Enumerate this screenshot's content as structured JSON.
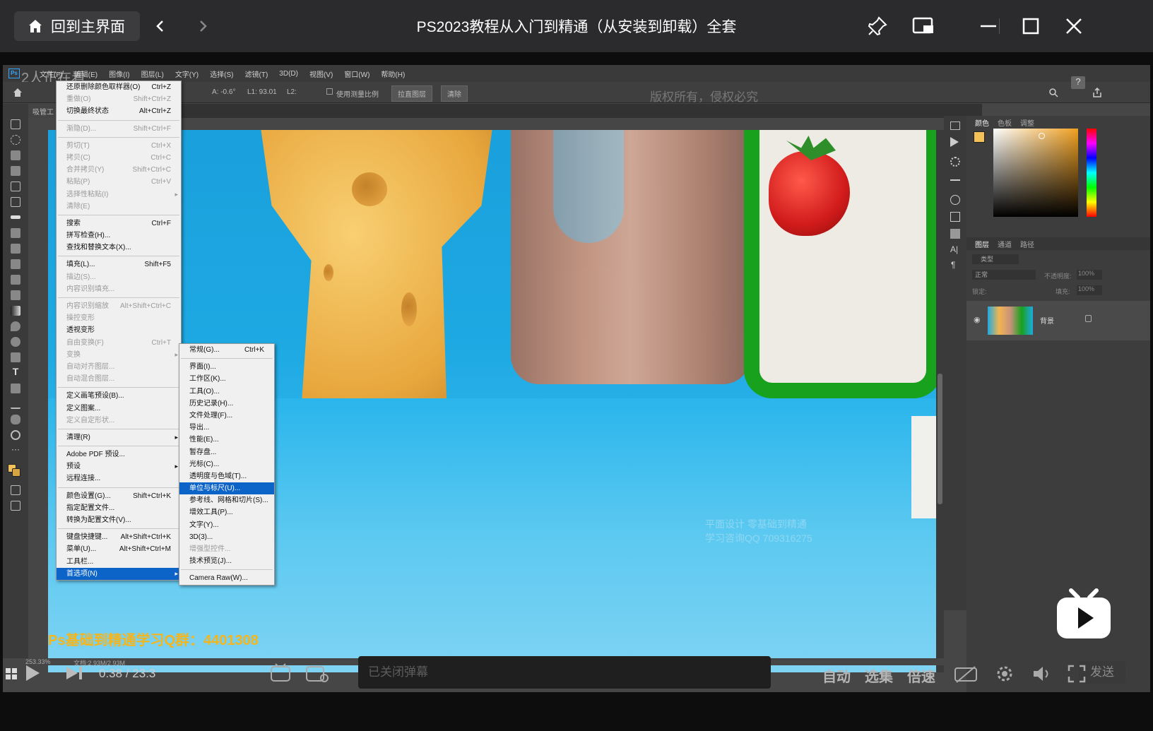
{
  "titlebar": {
    "home_label": "回到主界面",
    "title": "PS2023教程从入门到精通（从安装到卸载）全套"
  },
  "ps": {
    "menubar": [
      "文件(F)",
      "编辑(E)",
      "图像(I)",
      "图层(L)",
      "文字(Y)",
      "选择(S)",
      "滤镜(T)",
      "3D(D)",
      "视图(V)",
      "窗口(W)",
      "帮助(H)"
    ],
    "overlay_text": "2人正在看",
    "options": {
      "a": "A: -0.6°",
      "l1": "L1: 93.01",
      "l2": "L2:",
      "use_scale": "使用测量比例",
      "straighten": "拉直图层",
      "clear": "清除",
      "copyright": "版权所有，侵权必究"
    },
    "doc_tab": "吸管工",
    "status_zoom": "253.33%",
    "status_doc": "文档:2.93M/2.93M"
  },
  "edit_menu": [
    {
      "label": "还原删除颜色取样器(O)",
      "shortcut": "Ctrl+Z"
    },
    {
      "label": "重做(O)",
      "shortcut": "Shift+Ctrl+Z",
      "disabled": true
    },
    {
      "label": "切换最终状态",
      "shortcut": "Alt+Ctrl+Z"
    },
    {
      "sep": true
    },
    {
      "label": "渐隐(D)...",
      "shortcut": "Shift+Ctrl+F",
      "disabled": true
    },
    {
      "sep": true
    },
    {
      "label": "剪切(T)",
      "shortcut": "Ctrl+X",
      "disabled": true
    },
    {
      "label": "拷贝(C)",
      "shortcut": "Ctrl+C",
      "disabled": true
    },
    {
      "label": "合并拷贝(Y)",
      "shortcut": "Shift+Ctrl+C",
      "disabled": true
    },
    {
      "label": "粘贴(P)",
      "shortcut": "Ctrl+V",
      "disabled": true
    },
    {
      "label": "选择性粘贴(I)",
      "shortcut": "",
      "disabled": true,
      "submenu": true
    },
    {
      "label": "清除(E)",
      "shortcut": "",
      "disabled": true
    },
    {
      "sep": true
    },
    {
      "label": "搜索",
      "shortcut": "Ctrl+F"
    },
    {
      "label": "拼写检查(H)...",
      "shortcut": ""
    },
    {
      "label": "查找和替换文本(X)...",
      "shortcut": ""
    },
    {
      "sep": true
    },
    {
      "label": "填充(L)...",
      "shortcut": "Shift+F5"
    },
    {
      "label": "描边(S)...",
      "shortcut": "",
      "disabled": true
    },
    {
      "label": "内容识别填充...",
      "shortcut": "",
      "disabled": true
    },
    {
      "sep": true
    },
    {
      "label": "内容识别缩放",
      "shortcut": "Alt+Shift+Ctrl+C",
      "disabled": true
    },
    {
      "label": "操控变形",
      "shortcut": "",
      "disabled": true
    },
    {
      "label": "透视变形",
      "shortcut": ""
    },
    {
      "label": "自由变换(F)",
      "shortcut": "Ctrl+T",
      "disabled": true
    },
    {
      "label": "变换",
      "shortcut": "",
      "disabled": true,
      "submenu": true
    },
    {
      "label": "自动对齐图层...",
      "shortcut": "",
      "disabled": true
    },
    {
      "label": "自动混合图层...",
      "shortcut": "",
      "disabled": true
    },
    {
      "sep": true
    },
    {
      "label": "定义画笔预设(B)...",
      "shortcut": ""
    },
    {
      "label": "定义图案...",
      "shortcut": ""
    },
    {
      "label": "定义自定形状...",
      "shortcut": "",
      "disabled": true
    },
    {
      "sep": true
    },
    {
      "label": "清理(R)",
      "shortcut": "",
      "submenu": true
    },
    {
      "sep": true
    },
    {
      "label": "Adobe PDF 预设...",
      "shortcut": ""
    },
    {
      "label": "预设",
      "shortcut": "",
      "submenu": true
    },
    {
      "label": "远程连接...",
      "shortcut": ""
    },
    {
      "sep": true
    },
    {
      "label": "颜色设置(G)...",
      "shortcut": "Shift+Ctrl+K"
    },
    {
      "label": "指定配置文件...",
      "shortcut": ""
    },
    {
      "label": "转换为配置文件(V)...",
      "shortcut": ""
    },
    {
      "sep": true
    },
    {
      "label": "键盘快捷键...",
      "shortcut": "Alt+Shift+Ctrl+K"
    },
    {
      "label": "菜单(U)...",
      "shortcut": "Alt+Shift+Ctrl+M"
    },
    {
      "label": "工具栏...",
      "shortcut": ""
    },
    {
      "label": "首选项(N)",
      "shortcut": "",
      "submenu": true,
      "highlight": true
    }
  ],
  "prefs_menu": [
    {
      "label": "常规(G)...",
      "shortcut": "Ctrl+K"
    },
    {
      "sep": true
    },
    {
      "label": "界面(I)..."
    },
    {
      "label": "工作区(K)..."
    },
    {
      "label": "工具(O)..."
    },
    {
      "label": "历史记录(H)..."
    },
    {
      "label": "文件处理(F)..."
    },
    {
      "label": "导出..."
    },
    {
      "label": "性能(E)..."
    },
    {
      "label": "暂存盘..."
    },
    {
      "label": "光标(C)..."
    },
    {
      "label": "透明度与色域(T)..."
    },
    {
      "label": "单位与标尺(U)...",
      "highlight": true
    },
    {
      "label": "参考线、网格和切片(S)..."
    },
    {
      "label": "增效工具(P)..."
    },
    {
      "label": "文字(Y)..."
    },
    {
      "label": "3D(3)..."
    },
    {
      "label": "增强型控件...",
      "disabled": true
    },
    {
      "label": "技术预览(J)..."
    },
    {
      "sep": true
    },
    {
      "label": "Camera Raw(W)..."
    }
  ],
  "right_panel": {
    "color_tabs": [
      "颜色",
      "色板",
      "调整"
    ],
    "layer_tabs": [
      "图层",
      "通道",
      "路径"
    ],
    "kind": "类型",
    "blend": "正常",
    "opacity_label": "不透明度:",
    "opacity": "100%",
    "lock_label": "锁定:",
    "fill_label": "填充:",
    "fill": "100%",
    "layer_name": "背景"
  },
  "canvas": {
    "watermark_line1": "平面设计 零基础到精通",
    "watermark_line2": "学习咨询QQ 709316275",
    "ad_text": "Ps基础到精通学习Q群：4401308"
  },
  "player": {
    "time_current": "0:38",
    "time_total": "23:3",
    "danmaku_placeholder": "已关闭弹幕",
    "send": "发送",
    "auto": "自动",
    "episodes": "选集",
    "speed": "倍速"
  }
}
